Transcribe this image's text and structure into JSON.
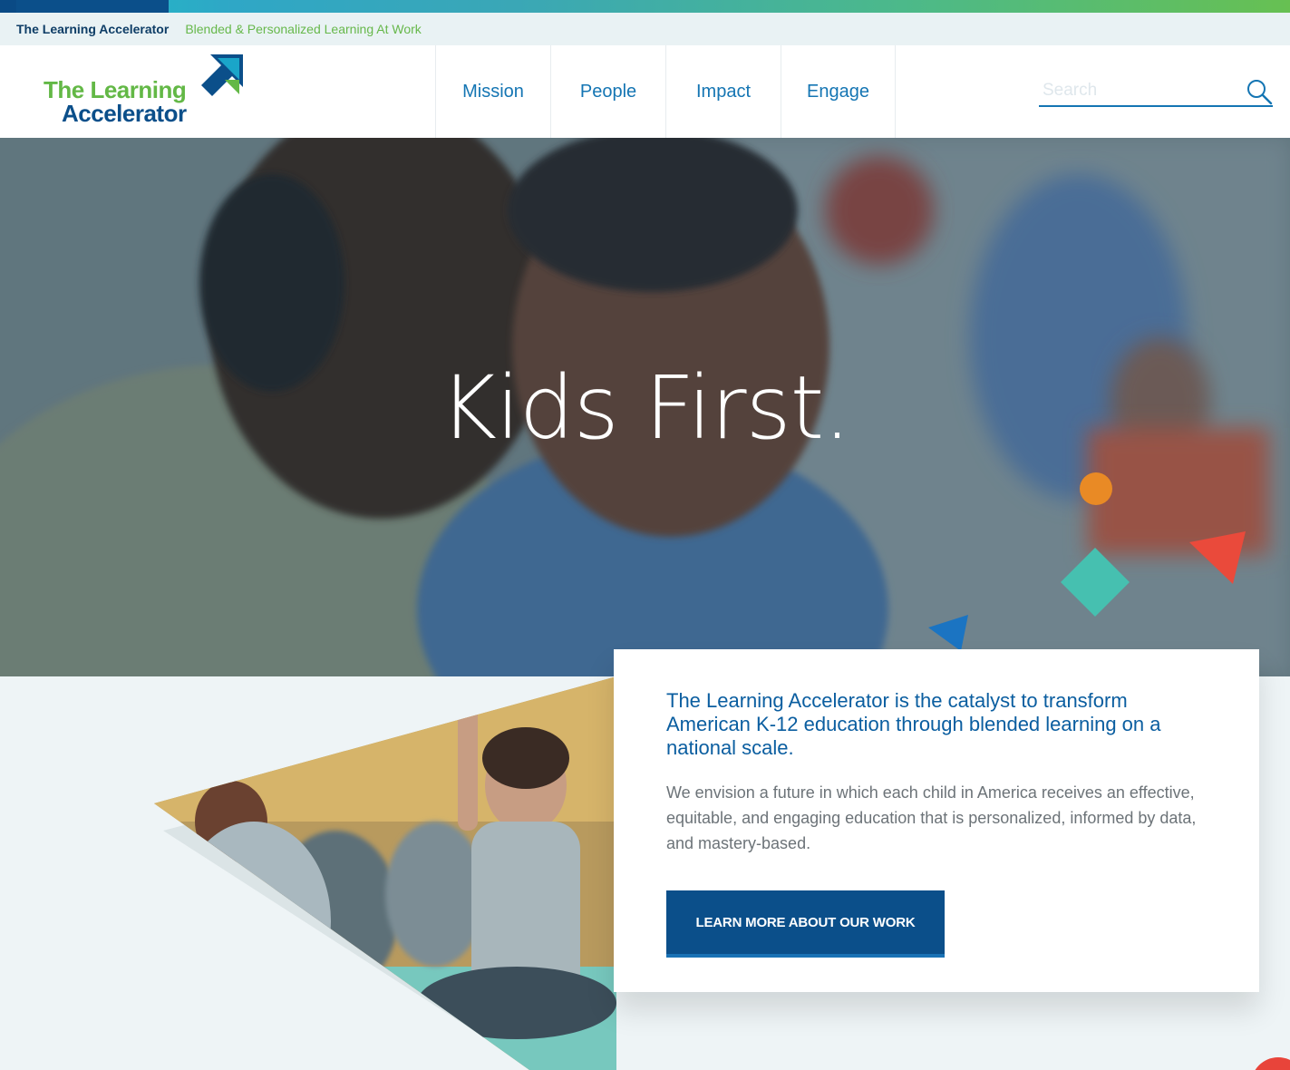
{
  "utility": {
    "site_name": "The Learning Accelerator",
    "tagline": "Blended & Personalized Learning At Work"
  },
  "header": {
    "logo_line1": "The Learning",
    "logo_line2": "Accelerator",
    "nav": [
      "Mission",
      "People",
      "Impact",
      "Engage"
    ],
    "search_placeholder": "Search"
  },
  "hero": {
    "title": "Kids First."
  },
  "info": {
    "lead": "The Learning Accelerator is the catalyst to transform American K-12 education through blended learning on a national scale.",
    "body": "We envision a future in which each child in America receives an effective, equitable, and engaging education that is personalized, informed by data, and mastery-based.",
    "cta": "LEARN MORE ABOUT OUR WORK"
  },
  "colors": {
    "brand_blue": "#0b4f8a",
    "brand_green": "#63b846",
    "link_blue": "#1475b3",
    "accent_orange": "#e98a25",
    "accent_red": "#ea4a3b",
    "accent_teal": "#46c0b0"
  },
  "icons": {
    "logo_mark": "arrow-up-right-icon",
    "search": "search-icon"
  }
}
